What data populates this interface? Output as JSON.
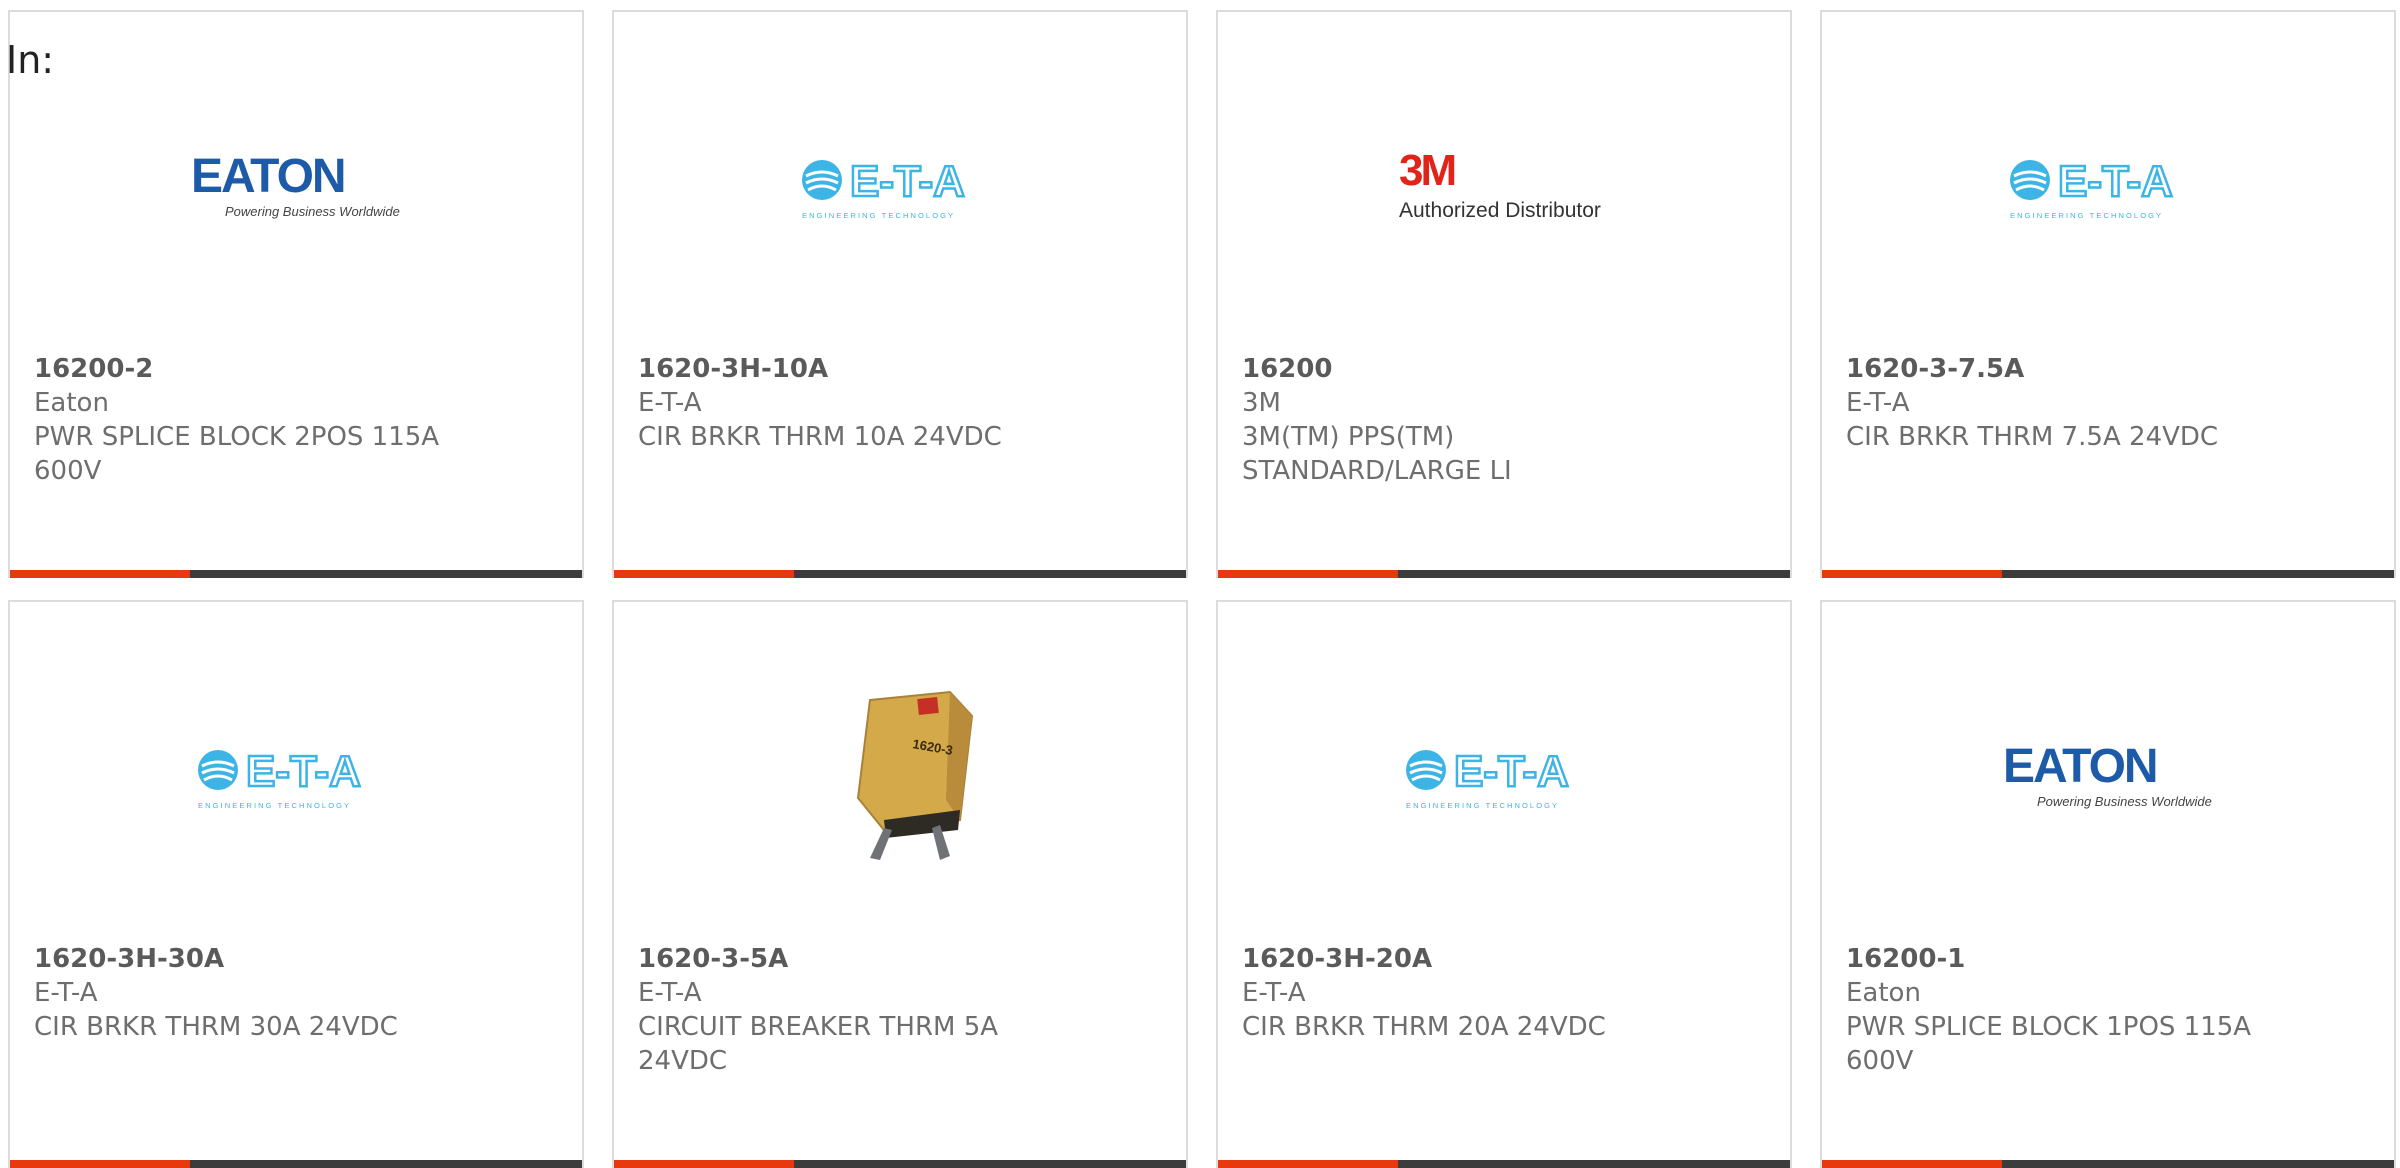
{
  "prefix_label": "In:",
  "products": [
    {
      "part_number": "16200-2",
      "manufacturer": "Eaton",
      "description": "PWR SPLICE BLOCK 2POS 115A 600V",
      "logo": "eaton-logo",
      "logo_tagline": "Powering Business Worldwide",
      "logo_text": "EATON"
    },
    {
      "part_number": "1620-3H-10A",
      "manufacturer": "E-T-A",
      "description": "CIR BRKR THRM 10A 24VDC",
      "logo": "eta-logo",
      "logo_tagline": "ENGINEERING TECHNOLOGY",
      "logo_text": "E-T-A"
    },
    {
      "part_number": "16200",
      "manufacturer": "3M",
      "description": "3M(TM) PPS(TM) STANDARD/LARGE LI",
      "logo": "3m-logo",
      "logo_tagline": "Authorized Distributor",
      "logo_text": "3M"
    },
    {
      "part_number": "1620-3-7.5A",
      "manufacturer": "E-T-A",
      "description": "CIR BRKR THRM 7.5A 24VDC",
      "logo": "eta-logo",
      "logo_tagline": "ENGINEERING TECHNOLOGY",
      "logo_text": "E-T-A"
    },
    {
      "part_number": "1620-3H-30A",
      "manufacturer": "E-T-A",
      "description": "CIR BRKR THRM 30A 24VDC",
      "logo": "eta-logo",
      "logo_tagline": "ENGINEERING TECHNOLOGY",
      "logo_text": "E-T-A"
    },
    {
      "part_number": "1620-3-5A",
      "manufacturer": "E-T-A",
      "description": "CIRCUIT BREAKER THRM 5A 24VDC",
      "logo": "circuit-breaker-photo",
      "logo_tagline": "",
      "logo_text": "1620-3"
    },
    {
      "part_number": "1620-3H-20A",
      "manufacturer": "E-T-A",
      "description": "CIR BRKR THRM 20A 24VDC",
      "logo": "eta-logo",
      "logo_tagline": "ENGINEERING TECHNOLOGY",
      "logo_text": "E-T-A"
    },
    {
      "part_number": "16200-1",
      "manufacturer": "Eaton",
      "description": "PWR SPLICE BLOCK 1POS 115A 600V",
      "logo": "eaton-logo",
      "logo_tagline": "Powering Business Worldwide",
      "logo_text": "EATON"
    }
  ],
  "colors": {
    "accent": "#e8380d",
    "bar": "#3c3c3c",
    "eaton_blue": "#1d5ba8",
    "eta_blue": "#3cb4e6",
    "3m_red": "#e2231a"
  }
}
